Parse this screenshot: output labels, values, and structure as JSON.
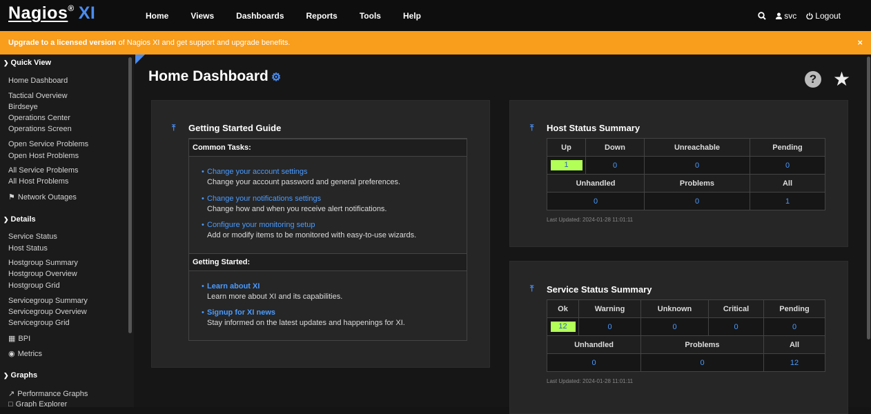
{
  "brand": {
    "name": "Nagios",
    "reg": "®",
    "suffix": "XI"
  },
  "nav": [
    "Home",
    "Views",
    "Dashboards",
    "Reports",
    "Tools",
    "Help"
  ],
  "user": {
    "name": "svc",
    "logout": "Logout"
  },
  "banner": {
    "bold": "Upgrade to a licensed version",
    "rest": " of Nagios XI and get support and upgrade benefits.",
    "close": "×"
  },
  "sidebar": {
    "quick_view": {
      "title": "Quick View",
      "items": [
        "Home Dashboard",
        "Tactical Overview",
        "Birdseye",
        "Operations Center",
        "Operations Screen",
        "Open Service Problems",
        "Open Host Problems",
        "All Service Problems",
        "All Host Problems",
        "Network Outages"
      ]
    },
    "details": {
      "title": "Details",
      "items": [
        "Service Status",
        "Host Status",
        "Hostgroup Summary",
        "Hostgroup Overview",
        "Hostgroup Grid",
        "Servicegroup Summary",
        "Servicegroup Overview",
        "Servicegroup Grid",
        "BPI",
        "Metrics"
      ]
    },
    "graphs": {
      "title": "Graphs",
      "items": [
        "Performance Graphs",
        "Graph Explorer"
      ]
    }
  },
  "page": {
    "title": "Home Dashboard"
  },
  "getting_started": {
    "title": "Getting Started Guide",
    "common_tasks_header": "Common Tasks:",
    "common_tasks": [
      {
        "link": "Change your account settings",
        "desc": "Change your account password and general preferences."
      },
      {
        "link": "Change your notifications settings",
        "desc": "Change how and when you receive alert notifications."
      },
      {
        "link": "Configure your monitoring setup",
        "desc": "Add or modify items to be monitored with easy-to-use wizards."
      }
    ],
    "started_header": "Getting Started:",
    "started": [
      {
        "link": "Learn about XI",
        "desc": "Learn more about XI and its capabilities."
      },
      {
        "link": "Signup for XI news",
        "desc": "Stay informed on the latest updates and happenings for XI."
      }
    ]
  },
  "host_status": {
    "title": "Host Status Summary",
    "headers": [
      "Up",
      "Down",
      "Unreachable",
      "Pending"
    ],
    "values": [
      "1",
      "0",
      "0",
      "0"
    ],
    "headers2": [
      "Unhandled",
      "Problems",
      "All"
    ],
    "values2": [
      "0",
      "0",
      "1"
    ],
    "updated": "Last Updated: 2024-01-28 11:01:11"
  },
  "service_status": {
    "title": "Service Status Summary",
    "headers": [
      "Ok",
      "Warning",
      "Unknown",
      "Critical",
      "Pending"
    ],
    "values": [
      "12",
      "0",
      "0",
      "0",
      "0"
    ],
    "headers2": [
      "Unhandled",
      "Problems",
      "All"
    ],
    "values2": [
      "0",
      "0",
      "12"
    ],
    "updated": "Last Updated: 2024-01-28 11:01:11"
  },
  "colors": {
    "accent": "#4a8cf0",
    "banner": "#f99d1c",
    "ok": "#b2ff57"
  }
}
